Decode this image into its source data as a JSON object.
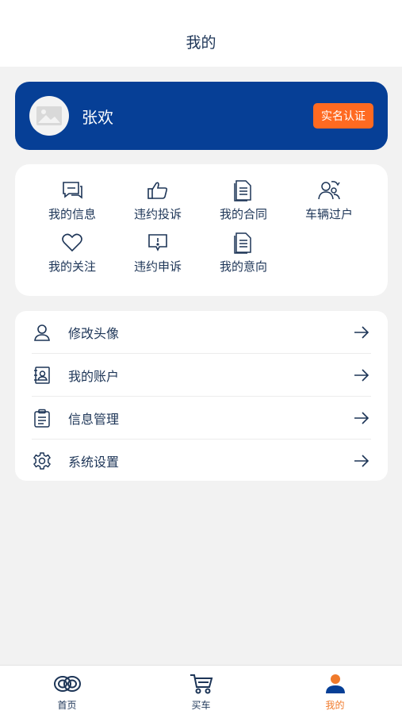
{
  "header": {
    "title": "我的"
  },
  "profile": {
    "name": "张欢",
    "verify_label": "实名认证"
  },
  "grid": {
    "items": [
      {
        "label": "我的信息",
        "icon": "message-icon"
      },
      {
        "label": "违约投诉",
        "icon": "thumbs-up-icon"
      },
      {
        "label": "我的合同",
        "icon": "document-icon"
      },
      {
        "label": "车辆过户",
        "icon": "users-transfer-icon"
      },
      {
        "label": "我的关注",
        "icon": "heart-icon"
      },
      {
        "label": "违约申诉",
        "icon": "alert-message-icon"
      },
      {
        "label": "我的意向",
        "icon": "document-icon"
      }
    ]
  },
  "menu": {
    "items": [
      {
        "label": "修改头像",
        "icon": "user-icon"
      },
      {
        "label": "我的账户",
        "icon": "contact-book-icon"
      },
      {
        "label": "信息管理",
        "icon": "clipboard-icon"
      },
      {
        "label": "系统设置",
        "icon": "gear-icon"
      }
    ]
  },
  "tabbar": {
    "items": [
      {
        "label": "首页",
        "icon": "home-rings-icon"
      },
      {
        "label": "买车",
        "icon": "cart-icon"
      },
      {
        "label": "我的",
        "icon": "person-icon",
        "active": true
      }
    ]
  },
  "colors": {
    "brand": "#063f96",
    "accent": "#ff6a21",
    "active_tab": "#f07a2b",
    "text": "#1d3557"
  }
}
